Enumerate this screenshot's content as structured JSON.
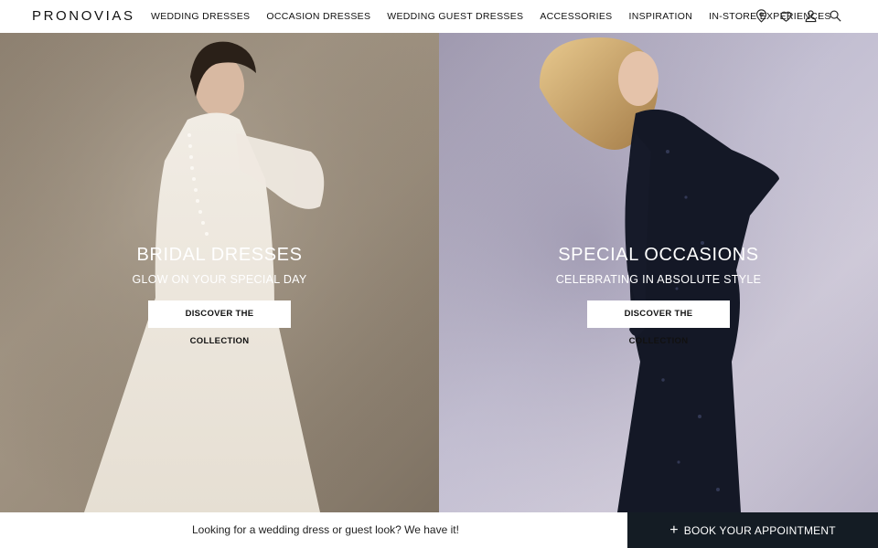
{
  "brand": {
    "name": "PRONOVIAS"
  },
  "nav": {
    "items": [
      {
        "label": "WEDDING DRESSES"
      },
      {
        "label": "OCCASION DRESSES"
      },
      {
        "label": "WEDDING GUEST DRESSES"
      },
      {
        "label": "ACCESSORIES"
      },
      {
        "label": "INSPIRATION"
      },
      {
        "label": "IN-STORE EXPERIENCES"
      }
    ]
  },
  "header_icons": [
    "location-pin-icon",
    "heart-icon",
    "user-icon",
    "search-icon"
  ],
  "panels": {
    "left": {
      "title": "BRIDAL DRESSES",
      "subtitle": "GLOW ON YOUR SPECIAL DAY",
      "cta": "DISCOVER THE COLLECTION"
    },
    "right": {
      "title": "SPECIAL OCCASIONS",
      "subtitle": "CELEBRATING IN ABSOLUTE STYLE",
      "cta": "DISCOVER THE COLLECTION"
    }
  },
  "bottom_bar": {
    "text": "Looking for a wedding dress or guest look? We have it!",
    "appointment_label": "BOOK YOUR APPOINTMENT",
    "appointment_icon": "plus-icon"
  },
  "colors": {
    "appointment_bg": "#141c24",
    "text": "#111111"
  }
}
